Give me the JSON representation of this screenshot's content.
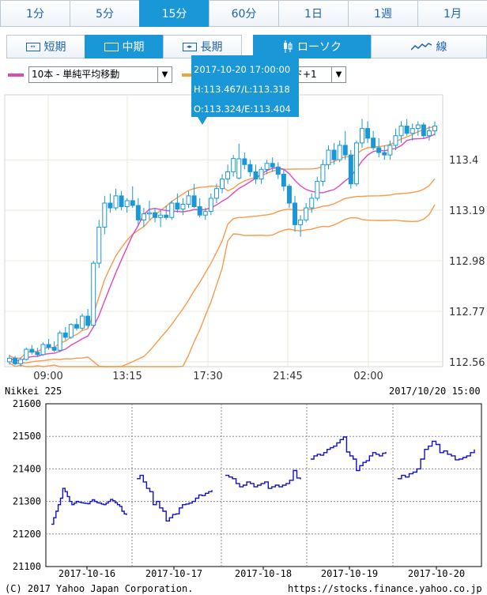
{
  "timeframes": {
    "items": [
      "1分",
      "5分",
      "15分",
      "60分",
      "1日",
      "1週",
      "1月"
    ],
    "active_index": 2
  },
  "periods": {
    "short": "短期",
    "mid": "中期",
    "long": "長期",
    "active": "mid"
  },
  "chart_types": {
    "candle": "ローソク",
    "line": "線",
    "active": "candle"
  },
  "indicators": {
    "ma_select": "10本 - 単純平均移動",
    "bb_select": "ド+1",
    "ma_color": "#d64fb0",
    "bb_color": "#f2a23a"
  },
  "tooltip": {
    "datetime": "2017-10-20 17:00:00",
    "hl": "H:113.467/L:113.318",
    "oe": "O:113.324/E:113.404"
  },
  "colors": {
    "accent": "#1a97d6",
    "candle": "#1a97d6",
    "ma": "#e048c0",
    "band": "#f79a4a",
    "nikkei_line": "#1010c8"
  },
  "chart_data": [
    {
      "type": "candlestick",
      "x_ticks": [
        "09:00",
        "13:15",
        "17:30",
        "21:45",
        "02:00"
      ],
      "y_ticks": [
        113.4,
        113.19,
        112.98,
        112.77,
        112.56
      ],
      "ylim": [
        112.54,
        113.67
      ],
      "grid": true,
      "candles": [
        [
          112.56,
          112.59,
          112.548,
          112.575
        ],
        [
          112.575,
          112.585,
          112.545,
          112.552
        ],
        [
          112.552,
          112.578,
          112.54,
          112.57
        ],
        [
          112.57,
          112.62,
          112.565,
          112.612
        ],
        [
          112.612,
          112.63,
          112.59,
          112.6
        ],
        [
          112.6,
          112.618,
          112.58,
          112.59
        ],
        [
          112.59,
          112.64,
          112.585,
          112.632
        ],
        [
          112.632,
          112.655,
          112.61,
          112.62
        ],
        [
          112.62,
          112.645,
          112.6,
          112.608
        ],
        [
          112.608,
          112.69,
          112.6,
          112.68
        ],
        [
          112.68,
          112.705,
          112.65,
          112.662
        ],
        [
          112.662,
          112.72,
          112.655,
          112.715
        ],
        [
          112.715,
          112.74,
          112.69,
          112.7
        ],
        [
          112.7,
          112.76,
          112.69,
          112.75
        ],
        [
          112.75,
          112.78,
          112.7,
          112.712
        ],
        [
          112.712,
          112.98,
          112.705,
          112.97
        ],
        [
          112.97,
          113.15,
          112.95,
          113.12
        ],
        [
          113.12,
          113.25,
          113.09,
          113.22
        ],
        [
          113.22,
          113.26,
          113.18,
          113.2
        ],
        [
          113.2,
          113.28,
          113.19,
          113.25
        ],
        [
          113.25,
          113.27,
          113.19,
          113.205
        ],
        [
          113.205,
          113.24,
          113.18,
          113.23
        ],
        [
          113.23,
          113.29,
          113.2,
          113.21
        ],
        [
          113.21,
          113.24,
          113.13,
          113.15
        ],
        [
          113.15,
          113.2,
          113.12,
          113.175
        ],
        [
          113.175,
          113.23,
          113.15,
          113.18
        ],
        [
          113.18,
          113.2,
          113.14,
          113.16
        ],
        [
          113.16,
          113.19,
          113.12,
          113.17
        ],
        [
          113.17,
          113.21,
          113.15,
          113.16
        ],
        [
          113.16,
          113.23,
          113.15,
          113.22
        ],
        [
          113.22,
          113.26,
          113.18,
          113.195
        ],
        [
          113.195,
          113.24,
          113.17,
          113.215
        ],
        [
          113.215,
          113.27,
          113.2,
          113.25
        ],
        [
          113.25,
          113.3,
          113.2,
          113.205
        ],
        [
          113.205,
          113.24,
          113.16,
          113.17
        ],
        [
          113.17,
          113.2,
          113.15,
          113.185
        ],
        [
          113.185,
          113.26,
          113.17,
          113.24
        ],
        [
          113.24,
          113.3,
          113.22,
          113.28
        ],
        [
          113.28,
          113.34,
          113.26,
          113.32
        ],
        [
          113.32,
          113.38,
          113.3,
          113.35
        ],
        [
          113.35,
          113.42,
          113.33,
          113.405
        ],
        [
          113.324,
          113.467,
          113.318,
          113.404
        ],
        [
          113.404,
          113.43,
          113.36,
          113.38
        ],
        [
          113.38,
          113.4,
          113.33,
          113.35
        ],
        [
          113.35,
          113.38,
          113.3,
          113.32
        ],
        [
          113.32,
          113.37,
          113.3,
          113.36
        ],
        [
          113.36,
          113.4,
          113.34,
          113.385
        ],
        [
          113.385,
          113.41,
          113.35,
          113.37
        ],
        [
          113.37,
          113.39,
          113.32,
          113.34
        ],
        [
          113.34,
          113.36,
          113.27,
          113.29
        ],
        [
          113.29,
          113.3,
          113.2,
          113.22
        ],
        [
          113.22,
          113.25,
          113.1,
          113.13
        ],
        [
          113.13,
          113.17,
          113.08,
          113.15
        ],
        [
          113.15,
          113.22,
          113.14,
          113.2
        ],
        [
          113.2,
          113.26,
          113.18,
          113.24
        ],
        [
          113.24,
          113.33,
          113.23,
          113.31
        ],
        [
          113.31,
          113.4,
          113.29,
          113.38
        ],
        [
          113.38,
          113.46,
          113.36,
          113.44
        ],
        [
          113.44,
          113.47,
          113.38,
          113.4
        ],
        [
          113.4,
          113.48,
          113.39,
          113.46
        ],
        [
          113.46,
          113.52,
          113.4,
          113.42
        ],
        [
          113.42,
          113.44,
          113.28,
          113.3
        ],
        [
          113.3,
          113.48,
          113.29,
          113.47
        ],
        [
          113.47,
          113.57,
          113.45,
          113.53
        ],
        [
          113.53,
          113.56,
          113.47,
          113.49
        ],
        [
          113.49,
          113.52,
          113.44,
          113.45
        ],
        [
          113.45,
          113.49,
          113.41,
          113.43
        ],
        [
          113.43,
          113.46,
          113.4,
          113.42
        ],
        [
          113.42,
          113.48,
          113.4,
          113.46
        ],
        [
          113.46,
          113.53,
          113.44,
          113.5
        ],
        [
          113.5,
          113.56,
          113.47,
          113.54
        ],
        [
          113.54,
          113.57,
          113.5,
          113.51
        ],
        [
          113.51,
          113.55,
          113.48,
          113.53
        ],
        [
          113.53,
          113.56,
          113.5,
          113.545
        ],
        [
          113.545,
          113.555,
          113.49,
          113.5
        ],
        [
          113.5,
          113.54,
          113.48,
          113.52
        ],
        [
          113.52,
          113.56,
          113.5,
          113.54
        ]
      ]
    },
    {
      "type": "line",
      "header_left": "Nikkei 225",
      "header_right": "2017/10/20 15:00",
      "y_ticks": [
        21600,
        21500,
        21400,
        21300,
        21200,
        21100
      ],
      "ylim": [
        21100,
        21600
      ],
      "x_labels": [
        "2017-10-16",
        "2017-10-17",
        "2017-10-18",
        "2017-10-19",
        "2017-10-20"
      ],
      "grid": true,
      "days": [
        [
          21230,
          21250,
          21270,
          21290,
          21310,
          21340,
          21330,
          21315,
          21300,
          21290,
          21295,
          21300,
          21298,
          21296,
          21295,
          21294,
          21293,
          21300,
          21305,
          21300,
          21296,
          21295,
          21292,
          21290,
          21295,
          21300,
          21306,
          21302,
          21296,
          21290,
          21285,
          21270,
          21262,
          21258
        ],
        [
          21370,
          21380,
          21360,
          21340,
          21330,
          21290,
          21300,
          21280,
          21270,
          21240,
          21250,
          21260,
          21262,
          21280,
          21290,
          21292,
          21295,
          21300,
          21310,
          21320,
          21318,
          21325,
          21330,
          21335
        ],
        [
          21380,
          21375,
          21370,
          21355,
          21345,
          21350,
          21360,
          21355,
          21345,
          21350,
          21355,
          21360,
          21340,
          21345,
          21350,
          21345,
          21350,
          21355,
          21365,
          21395,
          21372,
          21368
        ],
        [
          21430,
          21440,
          21445,
          21442,
          21450,
          21460,
          21465,
          21470,
          21480,
          21490,
          21498,
          21452,
          21440,
          21430,
          21395,
          21410,
          21420,
          21425,
          21440,
          21450,
          21445,
          21440,
          21448,
          21452
        ],
        [
          21370,
          21380,
          21375,
          21385,
          21390,
          21400,
          21430,
          21460,
          21470,
          21485,
          21475,
          21450,
          21455,
          21445,
          21440,
          21428,
          21430,
          21435,
          21440,
          21450,
          21460
        ]
      ]
    }
  ],
  "footer": {
    "copyright": "(C) 2017 Yahoo Japan Corporation.",
    "url": "https://stocks.finance.yahoo.co.jp"
  }
}
